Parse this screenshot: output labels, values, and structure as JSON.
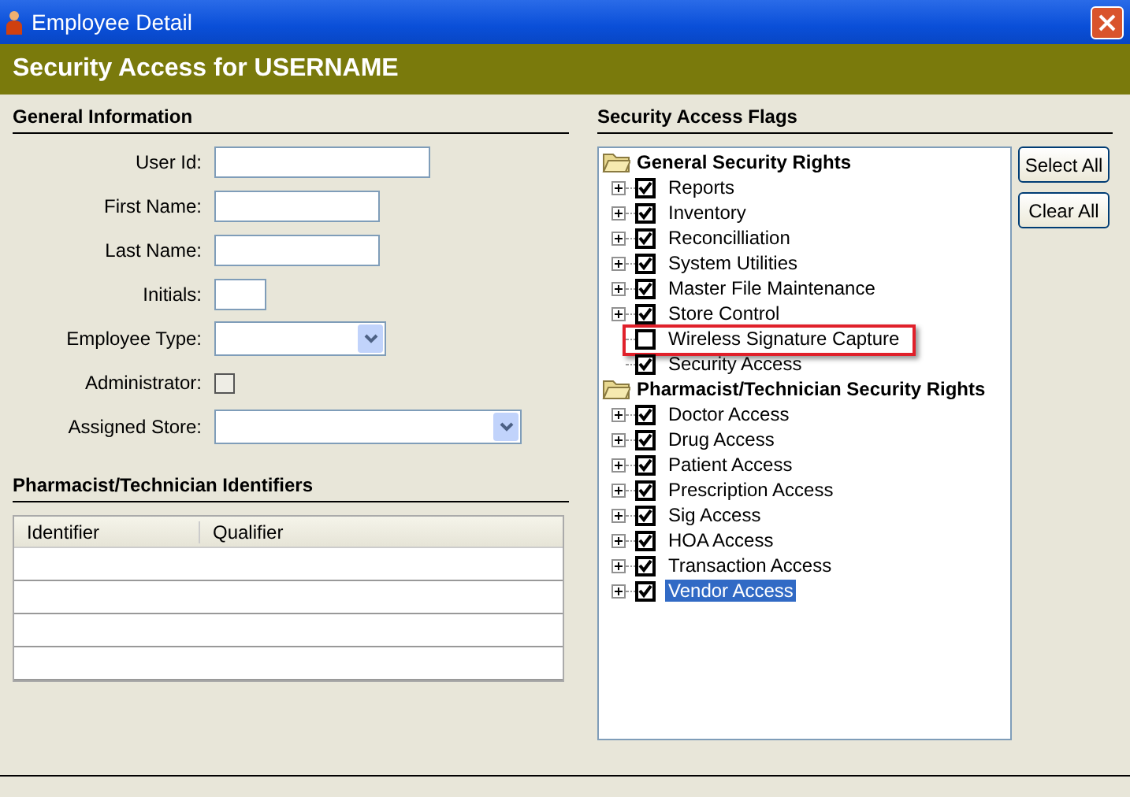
{
  "window": {
    "title": "Employee Detail"
  },
  "header": {
    "title": "Security Access for USERNAME"
  },
  "general_information": {
    "title": "General Information",
    "fields": [
      {
        "label": "User Id:",
        "kind": "text"
      },
      {
        "label": "First Name:",
        "kind": "text"
      },
      {
        "label": "Last Name:",
        "kind": "text"
      },
      {
        "label": "Initials:",
        "kind": "text"
      },
      {
        "label": "Employee Type:",
        "kind": "select"
      },
      {
        "label": "Administrator:",
        "kind": "checkbox",
        "checked": false
      },
      {
        "label": "Assigned Store:",
        "kind": "select"
      }
    ]
  },
  "identifiers": {
    "title": "Pharmacist/Technician Identifiers",
    "table": {
      "columns": [
        "Identifier",
        "Qualifier"
      ]
    }
  },
  "security_access_flags": {
    "title": "Security Access Flags",
    "tree": [
      {
        "label": "General Security Rights",
        "expanded": true,
        "children": [
          {
            "label": "Reports",
            "checked": true,
            "expandable": true,
            "selected": false,
            "highlighted": false
          },
          {
            "label": "Inventory",
            "checked": true,
            "expandable": true,
            "selected": false,
            "highlighted": false
          },
          {
            "label": "Reconcilliation",
            "checked": true,
            "expandable": true,
            "selected": false,
            "highlighted": false
          },
          {
            "label": "System Utilities",
            "checked": true,
            "expandable": true,
            "selected": false,
            "highlighted": false
          },
          {
            "label": "Master File Maintenance",
            "checked": true,
            "expandable": true,
            "selected": false,
            "highlighted": false
          },
          {
            "label": "Store Control",
            "checked": true,
            "expandable": true,
            "selected": false,
            "highlighted": false
          },
          {
            "label": "Wireless Signature Capture",
            "checked": false,
            "expandable": false,
            "selected": false,
            "highlighted": true
          },
          {
            "label": "Security Access",
            "checked": true,
            "expandable": false,
            "selected": false,
            "highlighted": false
          }
        ]
      },
      {
        "label": "Pharmacist/Technician Security Rights",
        "expanded": true,
        "children": [
          {
            "label": "Doctor Access",
            "checked": true,
            "expandable": true,
            "selected": false,
            "highlighted": false
          },
          {
            "label": "Drug Access",
            "checked": true,
            "expandable": true,
            "selected": false,
            "highlighted": false
          },
          {
            "label": "Patient Access",
            "checked": true,
            "expandable": true,
            "selected": false,
            "highlighted": false
          },
          {
            "label": "Prescription Access",
            "checked": true,
            "expandable": true,
            "selected": false,
            "highlighted": false
          },
          {
            "label": "Sig Access",
            "checked": true,
            "expandable": true,
            "selected": false,
            "highlighted": false
          },
          {
            "label": "HOA Access",
            "checked": true,
            "expandable": true,
            "selected": false,
            "highlighted": false
          },
          {
            "label": "Transaction Access",
            "checked": true,
            "expandable": true,
            "selected": false,
            "highlighted": false
          },
          {
            "label": "Vendor Access",
            "checked": true,
            "expandable": true,
            "selected": true,
            "highlighted": false
          }
        ]
      }
    ],
    "buttons": [
      "Select All",
      "Clear All"
    ]
  }
}
